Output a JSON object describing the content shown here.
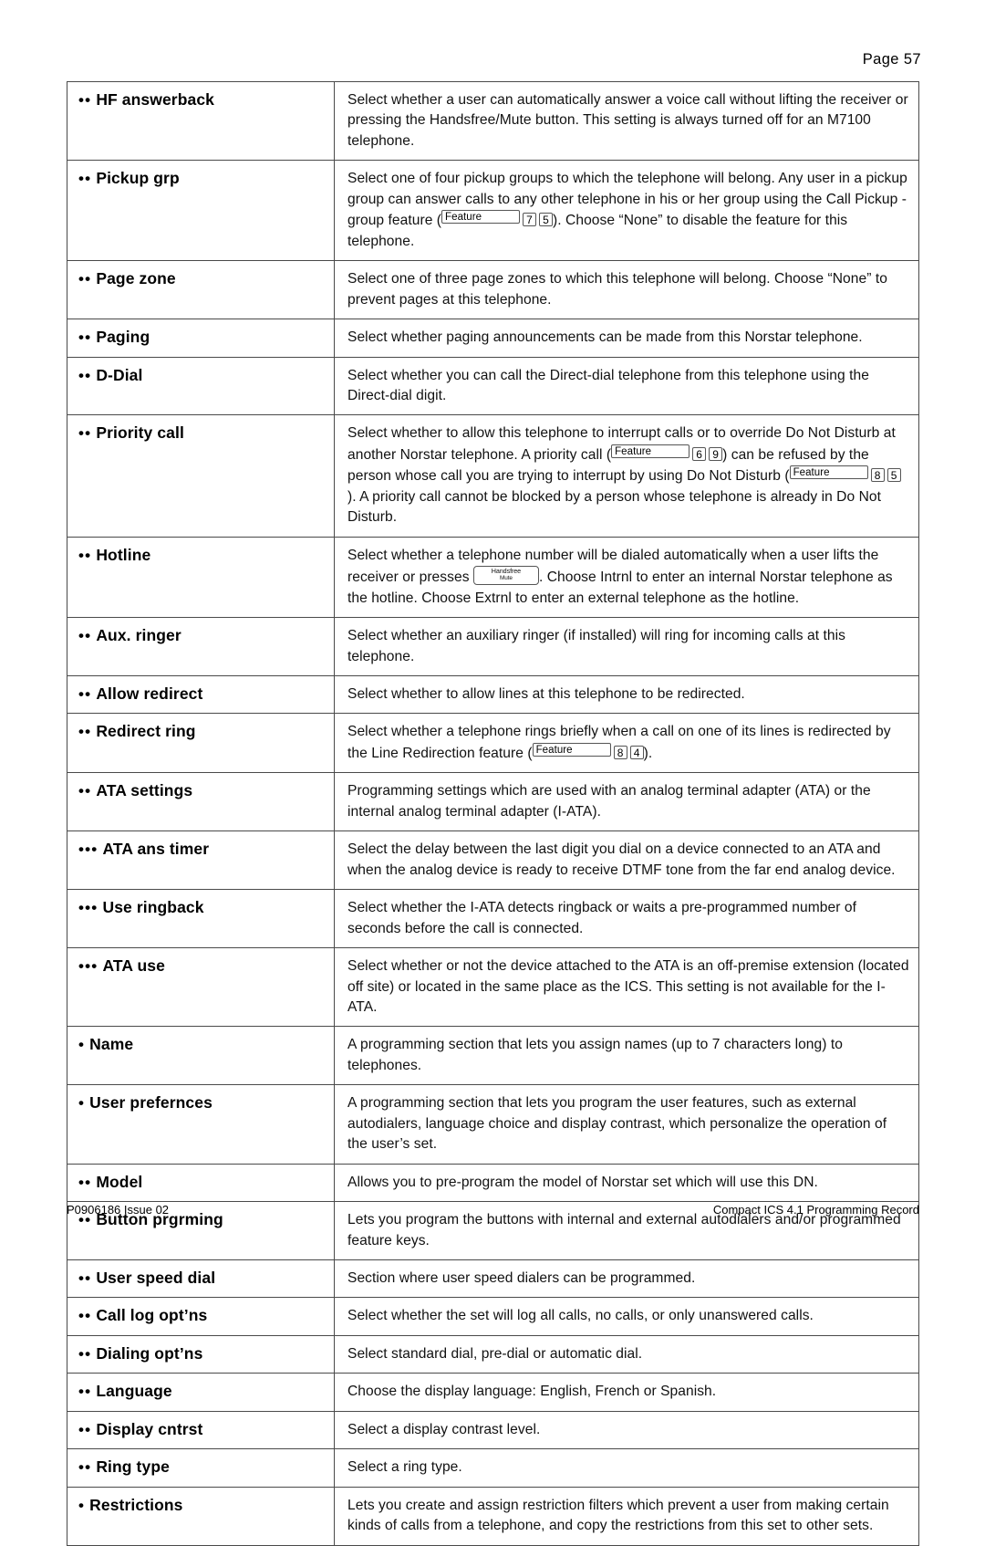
{
  "header": {
    "page_label": "Page  57"
  },
  "footer": {
    "left": "P0906186 Issue 02",
    "right": "Compact ICS 4.1 Programming Record"
  },
  "table": {
    "rows": [
      {
        "bullets": "••",
        "term": "HF answerback",
        "desc_parts": [
          {
            "type": "text",
            "value": "Select whether a user can automatically answer a voice call without lifting the receiver or pressing the Handsfree/Mute button. This setting is always turned off for an M7100 telephone."
          }
        ]
      },
      {
        "bullets": "••",
        "term": "Pickup grp",
        "desc_parts": [
          {
            "type": "text",
            "value": "Select one of four pickup groups to which the telephone will belong. Any user in a pickup group can answer calls to any other telephone in his or her group using the Call Pickup - group feature ("
          },
          {
            "type": "key-feature",
            "value": "Feature"
          },
          {
            "type": "key-digit",
            "value": "7"
          },
          {
            "type": "key-digit",
            "value": "5"
          },
          {
            "type": "text",
            "value": "). Choose “None” to disable the feature for this telephone."
          }
        ]
      },
      {
        "bullets": "••",
        "term": "Page zone",
        "desc_parts": [
          {
            "type": "text",
            "value": "Select one of three page zones to which this telephone will belong. Choose “None” to prevent pages at this telephone."
          }
        ]
      },
      {
        "bullets": "••",
        "term": "Paging",
        "desc_parts": [
          {
            "type": "text",
            "value": "Select whether paging announcements can be made from this Norstar telephone."
          }
        ]
      },
      {
        "bullets": "••",
        "term": "D-Dial",
        "desc_parts": [
          {
            "type": "text",
            "value": "Select whether you can call the Direct-dial telephone from this telephone using the Direct-dial digit."
          }
        ]
      },
      {
        "bullets": "••",
        "term": "Priority call",
        "desc_parts": [
          {
            "type": "text",
            "value": "Select whether to allow this telephone to interrupt calls or to override Do Not Disturb at another Norstar telephone. A priority call ("
          },
          {
            "type": "key-feature",
            "value": "Feature"
          },
          {
            "type": "key-digit",
            "value": "6"
          },
          {
            "type": "key-digit",
            "value": "9"
          },
          {
            "type": "text",
            "value": ") can be refused by the person whose call you are trying to interrupt by using Do Not Disturb ("
          },
          {
            "type": "key-feature",
            "value": "Feature"
          },
          {
            "type": "key-digit",
            "value": "8"
          },
          {
            "type": "key-digit",
            "value": "5"
          },
          {
            "type": "text",
            "value": "). A priority call cannot be blocked by a person whose telephone is already in Do Not Disturb."
          }
        ]
      },
      {
        "bullets": "••",
        "term": "Hotline",
        "desc_parts": [
          {
            "type": "text",
            "value": "Select whether a telephone number will be dialed automatically when a user lifts the receiver or presses "
          },
          {
            "type": "key-hfmute",
            "line1": "Handsfree",
            "line2": "Mute"
          },
          {
            "type": "text",
            "value": ". Choose Intrnl to enter an internal Norstar telephone as the hotline. Choose Extrnl to enter an external telephone as the hotline."
          }
        ]
      },
      {
        "bullets": "••",
        "term": "Aux. ringer",
        "desc_parts": [
          {
            "type": "text",
            "value": "Select whether an auxiliary ringer (if installed) will ring for incoming calls at this telephone."
          }
        ]
      },
      {
        "bullets": "••",
        "term": "Allow redirect",
        "desc_parts": [
          {
            "type": "text",
            "value": "Select whether to allow lines at this telephone to be redirected."
          }
        ]
      },
      {
        "bullets": "••",
        "term": "Redirect ring",
        "desc_parts": [
          {
            "type": "text",
            "value": "Select whether a telephone rings briefly when a call on one of its lines is redirected by the Line Redirection feature ("
          },
          {
            "type": "key-feature",
            "value": "Feature"
          },
          {
            "type": "key-digit",
            "value": "8"
          },
          {
            "type": "key-digit",
            "value": "4"
          },
          {
            "type": "text",
            "value": ")."
          }
        ]
      },
      {
        "bullets": "••",
        "term": "ATA settings",
        "desc_parts": [
          {
            "type": "text",
            "value": "Programming settings which are used with an analog terminal adapter (ATA) or the internal analog terminal adapter (I-ATA)."
          }
        ]
      },
      {
        "bullets": "•••",
        "term": "ATA ans timer",
        "desc_parts": [
          {
            "type": "text",
            "value": "Select the delay between the last digit you dial on a device connected to an ATA and when the analog device is ready to receive DTMF tone from the far end analog device."
          }
        ]
      },
      {
        "bullets": "•••",
        "term": "Use ringback",
        "desc_parts": [
          {
            "type": "text",
            "value": "Select whether the I-ATA detects ringback or waits a pre-programmed number of seconds before the call is connected."
          }
        ]
      },
      {
        "bullets": "•••",
        "term": "ATA use",
        "desc_parts": [
          {
            "type": "text",
            "value": "Select whether or not the device attached to the ATA is an off-premise extension (located off site) or located in the same place as the ICS. This setting is not available for the I-ATA."
          }
        ]
      },
      {
        "bullets": "•",
        "term": "Name",
        "desc_parts": [
          {
            "type": "text",
            "value": "A programming section that lets you assign names (up to 7 characters long) to telephones."
          }
        ]
      },
      {
        "bullets": "•",
        "term": "User prefernces",
        "desc_parts": [
          {
            "type": "text",
            "value": "A programming section that lets you program the user features, such as external autodialers, language choice and display contrast, which personalize the operation of the user’s set."
          }
        ]
      },
      {
        "bullets": "••",
        "term": "Model",
        "desc_parts": [
          {
            "type": "text",
            "value": "Allows you to pre-program the model of Norstar set which will use this DN."
          }
        ]
      },
      {
        "bullets": "••",
        "term": "Button prgrming",
        "desc_parts": [
          {
            "type": "text",
            "value": "Lets you program the buttons with internal and external autodialers and/or programmed feature keys."
          }
        ]
      },
      {
        "bullets": "••",
        "term": "User speed dial",
        "desc_parts": [
          {
            "type": "text",
            "value": "Section where user speed dialers can be programmed."
          }
        ]
      },
      {
        "bullets": "••",
        "term": "Call log opt’ns",
        "desc_parts": [
          {
            "type": "text",
            "value": "Select whether the set will log all calls, no calls, or only unanswered calls."
          }
        ]
      },
      {
        "bullets": "••",
        "term": "Dialing opt’ns",
        "desc_parts": [
          {
            "type": "text",
            "value": "Select standard dial, pre-dial or automatic dial."
          }
        ]
      },
      {
        "bullets": "••",
        "term": "Language",
        "desc_parts": [
          {
            "type": "text",
            "value": "Choose the display language: English, French or Spanish."
          }
        ]
      },
      {
        "bullets": "••",
        "term": "Display cntrst",
        "desc_parts": [
          {
            "type": "text",
            "value": "Select a display contrast level."
          }
        ]
      },
      {
        "bullets": "••",
        "term": "Ring type",
        "desc_parts": [
          {
            "type": "text",
            "value": "Select a ring type."
          }
        ]
      },
      {
        "bullets": "•",
        "term": "Restrictions",
        "desc_parts": [
          {
            "type": "text",
            "value": "Lets you create and assign restriction filters which prevent a user from making certain kinds of calls from a telephone, and copy the restrictions from this set to other sets."
          }
        ]
      }
    ]
  }
}
